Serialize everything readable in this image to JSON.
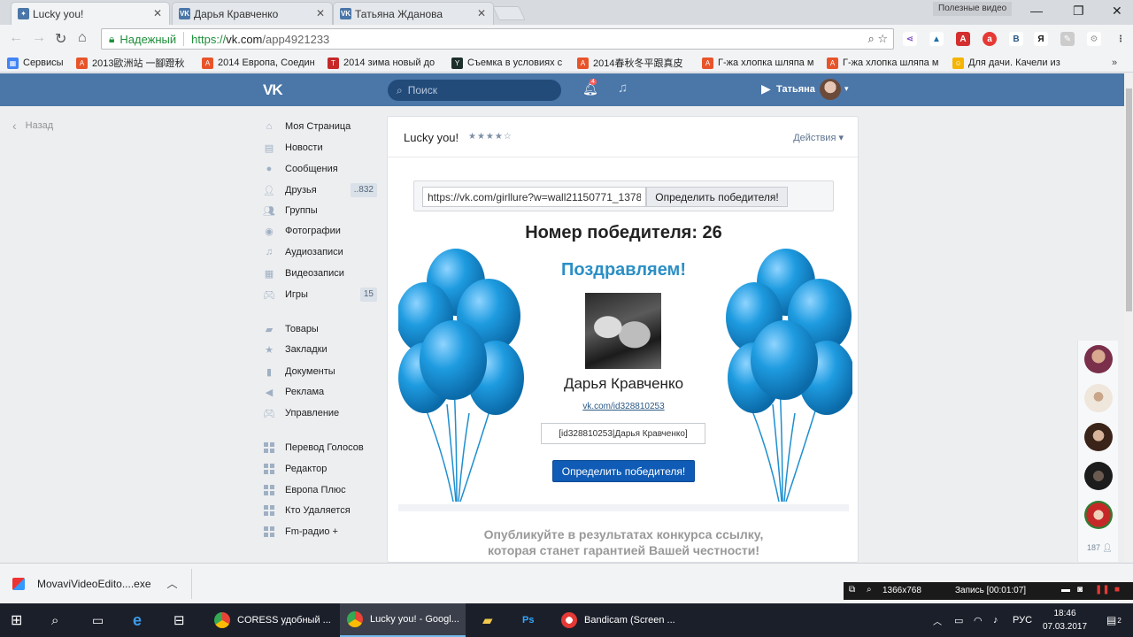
{
  "browser": {
    "tabs": [
      {
        "title": "Lucky you!",
        "active": true
      },
      {
        "title": "Дарья Кравченко",
        "active": false
      },
      {
        "title": "Татьяна Жданова",
        "active": false
      }
    ],
    "useful_video": "Полезные видео",
    "secure_label": "Надежный",
    "url_scheme": "https://",
    "url_host": "vk.com",
    "url_path": "/app4921233",
    "bookmarks": [
      "Сервисы",
      "2013歐洲站 一腳蹬秋",
      "2014 Европа, Соедин",
      "2014 зима новый до",
      "Съемка в условиях с",
      "2014春秋冬平跟真皮",
      "Г-жа хлопка шляпа м",
      "Г-жа хлопка шляпа м",
      "Для дачи. Качели из"
    ]
  },
  "vk": {
    "search_placeholder": "Поиск",
    "notifications_count": "4",
    "user_name": "Татьяна",
    "back_label": "Назад",
    "menu": [
      {
        "label": "Моя Страница",
        "icon": "home-icon"
      },
      {
        "label": "Новости",
        "icon": "news-icon"
      },
      {
        "label": "Сообщения",
        "icon": "messages-icon"
      },
      {
        "label": "Друзья",
        "icon": "friends-icon",
        "count": "..832"
      },
      {
        "label": "Группы",
        "icon": "groups-icon"
      },
      {
        "label": "Фотографии",
        "icon": "camera-icon"
      },
      {
        "label": "Аудиозаписи",
        "icon": "music-icon"
      },
      {
        "label": "Видеозаписи",
        "icon": "video-icon"
      },
      {
        "label": "Игры",
        "icon": "games-icon",
        "count": "15"
      },
      {
        "label": "Товары",
        "icon": "bag-icon"
      },
      {
        "label": "Закладки",
        "icon": "star-icon"
      },
      {
        "label": "Документы",
        "icon": "document-icon"
      },
      {
        "label": "Реклама",
        "icon": "megaphone-icon"
      },
      {
        "label": "Управление",
        "icon": "gamepad-icon"
      },
      {
        "label": "Перевод Голосов",
        "icon": "app-grid-icon"
      },
      {
        "label": "Редактор",
        "icon": "app-grid-icon"
      },
      {
        "label": "Европа Плюс",
        "icon": "app-grid-icon"
      },
      {
        "label": "Кто Удаляется",
        "icon": "app-grid-icon"
      },
      {
        "label": "Fm-радио +",
        "icon": "app-grid-icon"
      }
    ],
    "friends_online_count": "187"
  },
  "app": {
    "title": "Lucky you!",
    "rating_stars": "★★★★☆",
    "actions_label": "Действия",
    "url_input_value": "https://vk.com/girllure?w=wall21150771_1378",
    "determine_button": "Определить победителя!",
    "winner_number": "Номер победителя: 26",
    "congrats": "Поздравляем!",
    "winner_name": "Дарья Кравченко",
    "winner_link": "vk.com/id328810253",
    "winner_field_value": "[id328810253|Дарья Кравченко]",
    "determine_button_primary": "Определить победителя!",
    "publish_line1": "Опубликуйте в результатах конкурса ссылку,",
    "publish_line2": "которая станет гарантией Вашей честности!"
  },
  "downloads": {
    "file_name": "MovaviVideoEdito....exe"
  },
  "bandicam": {
    "resolution": "1366x768",
    "recording": "Запись [00:01:07]"
  },
  "taskbar": {
    "tasks": [
      {
        "label": "CORESS удобный ...",
        "active": false
      },
      {
        "label": "Lucky you! - Googl...",
        "active": true
      },
      {
        "label": "Bandicam (Screen ...",
        "active": false
      }
    ],
    "language": "РУС",
    "time": "18:46",
    "date": "07.03.2017",
    "notification_count": "2"
  },
  "colors": {
    "vk_blue": "#4a76a8",
    "balloon_blue": "#1e9be0",
    "congrats_blue": "#2b8fc5",
    "primary_button": "#0f5bb5"
  }
}
